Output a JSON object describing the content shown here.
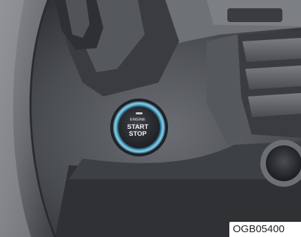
{
  "button": {
    "line1": "ENGINE",
    "line2": "START",
    "line3": "STOP"
  },
  "figure_code": "OGB05400",
  "colors": {
    "dash": "#5b5e63",
    "dash_dark": "#2f3135",
    "ring_blue": "#4b9fc3",
    "button_face": "#2a2c30"
  },
  "icons": {
    "button_indicator": "indicator-led-icon"
  }
}
